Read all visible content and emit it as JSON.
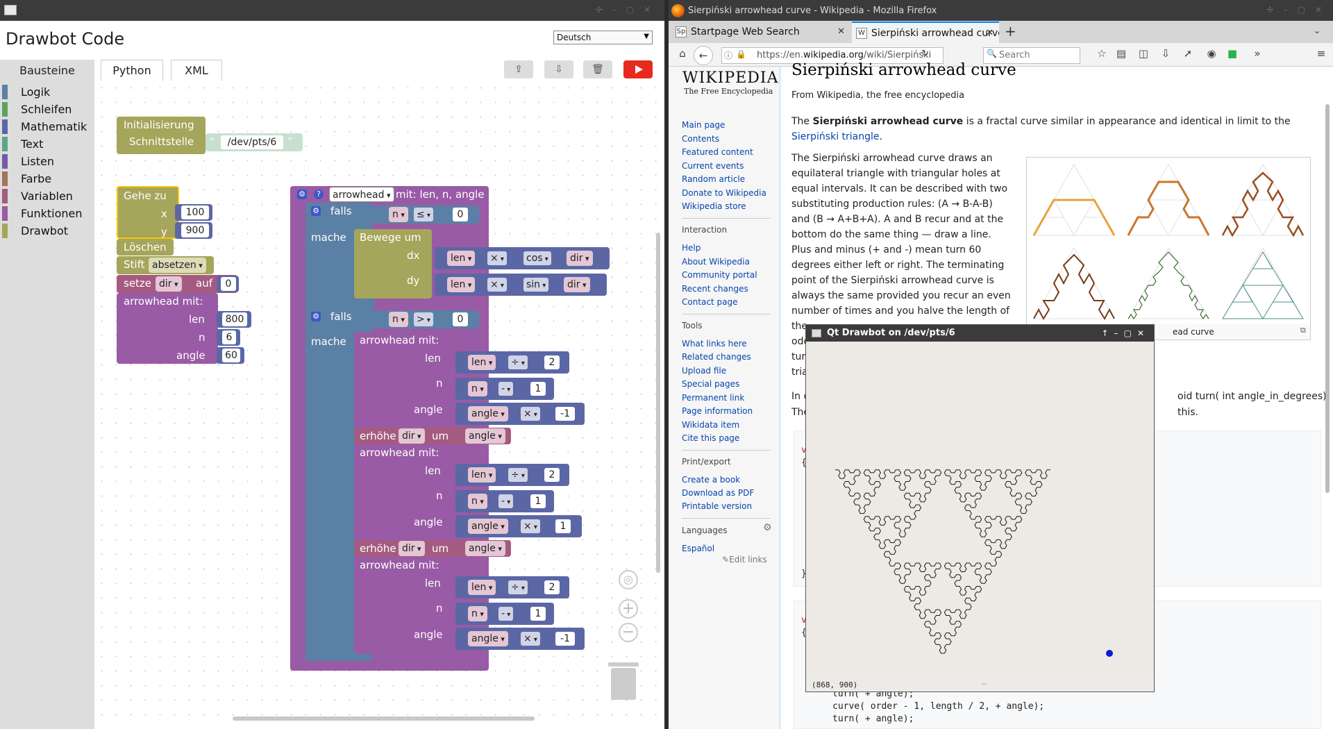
{
  "left_window": {
    "app_title": "Drawbot Code",
    "language": "Deutsch",
    "tabs": [
      "Bausteine",
      "Python",
      "XML"
    ],
    "categories": [
      {
        "label": "Logik",
        "color": "#5b80a5"
      },
      {
        "label": "Schleifen",
        "color": "#5ba55b"
      },
      {
        "label": "Mathematik",
        "color": "#5b67a5"
      },
      {
        "label": "Text",
        "color": "#5ba58c"
      },
      {
        "label": "Listen",
        "color": "#745ba5"
      },
      {
        "label": "Farbe",
        "color": "#a5745b"
      },
      {
        "label": "Variablen",
        "color": "#a55b80"
      },
      {
        "label": "Funktionen",
        "color": "#995ba5"
      },
      {
        "label": "Drawbot",
        "color": "#a5a55b"
      }
    ],
    "blocks": {
      "init_label": "Initialisierung",
      "interface_label": "Schnittstelle",
      "interface_value": "/dev/pts/6",
      "goto_label": "Gehe zu",
      "x_label": "x",
      "x_value": "100",
      "y_label": "y",
      "y_value": "900",
      "clear_label": "Löschen",
      "pen_label": "Stift",
      "pen_value": "absetzen",
      "set_label": "setze",
      "set_var": "dir",
      "set_to": "auf",
      "set_value": "0",
      "call_label": "arrowhead",
      "call_with": "mit:",
      "param_len": "len",
      "param_n": "n",
      "param_angle": "angle",
      "call_len": "800",
      "call_n": "6",
      "call_angle": "60",
      "def_name": "arrowhead",
      "def_params": "mit: len, n, angle",
      "if_label": "falls",
      "do_label": "mache",
      "cond1_var": "n",
      "cond1_op": "≤",
      "cond1_val": "0",
      "move_label": "Bewege um",
      "dx_label": "dx",
      "dy_label": "dy",
      "times_op": "×",
      "cos_fn": "cos",
      "sin_fn": "sin",
      "dir_var": "dir",
      "cond2_var": "n",
      "cond2_op": ">",
      "cond2_val": "0",
      "div_op": "÷",
      "minus_op": "-",
      "two": "2",
      "one": "1",
      "neg_one": "-1",
      "inc_label": "erhöhe",
      "inc_var": "dir",
      "inc_by": "um",
      "inc_val": "angle"
    }
  },
  "right_window": {
    "window_title": "Sierpiński arrowhead curve - Wikipedia - Mozilla Firefox",
    "tab1": "Startpage Web Search",
    "tab2": "Sierpiński arrowhead curve...",
    "url_prefix": "https://en.",
    "url_domain": "wikipedia.org",
    "url_path": "/wiki/Sierpiński",
    "search_placeholder": "Search",
    "wiki_logo": "Wikipedia",
    "wiki_tagline": "The Free Encyclopedia",
    "nav_links": [
      "Main page",
      "Contents",
      "Featured content",
      "Current events",
      "Random article",
      "Donate to Wikipedia",
      "Wikipedia store"
    ],
    "interaction_head": "Interaction",
    "interaction_links": [
      "Help",
      "About Wikipedia",
      "Community portal",
      "Recent changes",
      "Contact page"
    ],
    "tools_head": "Tools",
    "tools_links": [
      "What links here",
      "Related changes",
      "Upload file",
      "Special pages",
      "Permanent link",
      "Page information",
      "Wikidata item",
      "Cite this page"
    ],
    "print_head": "Print/export",
    "print_links": [
      "Create a book",
      "Download as PDF",
      "Printable version"
    ],
    "languages_head": "Languages",
    "lang_link": "Español",
    "edit_links": "Edit links",
    "article_title": "Sierpiński arrowhead curve",
    "from_wiki": "From Wikipedia, the free encyclopedia",
    "p1_pre": "The ",
    "p1_bold": "Sierpiński arrowhead curve",
    "p1_post": " is a fractal curve similar in appearance and identical in limit to the",
    "p1_link": "Sierpiński triangle",
    "p1_end": ".",
    "p2_lines": [
      "The Sierpiński arrowhead curve draws an",
      "equilateral triangle with triangular holes at",
      "equal intervals. It can be described with two",
      "substituting production rules: (A → B-A-B)",
      "and (B → A+B+A). A and B recur and at the",
      "bottom do the same thing — draw a line.",
      "Plus and minus (+ and -) mean turn 60",
      "degrees either left or right. The terminating",
      "point of the Sierpiński arrowhead curve is",
      "always the same provided you recur an even",
      "number of times and you halve the length of",
      "the",
      "odd",
      "tur",
      "tria"
    ],
    "p3_start": "In c",
    "p3_right": "oid turn( int angle_in_degrees);",
    "p4_start": "The",
    "p4_right": "this.",
    "caption_tail": "ead curve",
    "code_lines": [
      "turn( + angle);",
      "curve( order - 1, length / 2, + angle);",
      "turn( + angle);"
    ]
  },
  "qt_window": {
    "title": "Qt Drawbot on /dev/pts/6",
    "status": "(868, 900)",
    "status2": ".."
  }
}
